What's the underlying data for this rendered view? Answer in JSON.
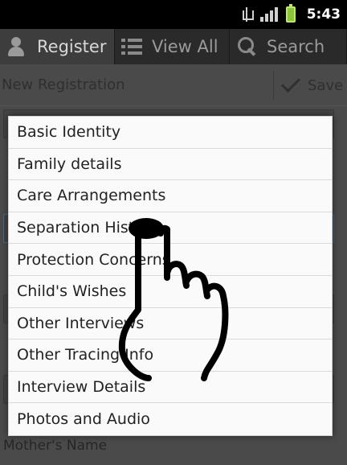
{
  "status_bar": {
    "time": "5:43",
    "icons": [
      "usb-icon",
      "signal-icon",
      "battery-icon"
    ]
  },
  "tabs": [
    {
      "label": "Register",
      "icon": "person-icon",
      "active": true
    },
    {
      "label": "View All",
      "icon": "list-icon",
      "active": false
    },
    {
      "label": "Search",
      "icon": "search-icon",
      "active": false
    }
  ],
  "form": {
    "title": "New Registration",
    "save_label": "Save",
    "bottom_label": "Mother's Name"
  },
  "dropdown": {
    "options": [
      "Basic Identity",
      "Family details",
      "Care Arrangements",
      "Separation History",
      "Protection Concerns",
      "Child's Wishes",
      "Other Interviews",
      "Other Tracing Info",
      "Interview Details",
      "Photos and Audio"
    ]
  },
  "overlay": {
    "icon": "pointing-hand-icon"
  },
  "colors": {
    "status_bar_bg": "#000000",
    "tab_bar_bg": "#2a2a2a",
    "dropdown_bg": "#fafafa",
    "battery": "#8bc33a"
  }
}
